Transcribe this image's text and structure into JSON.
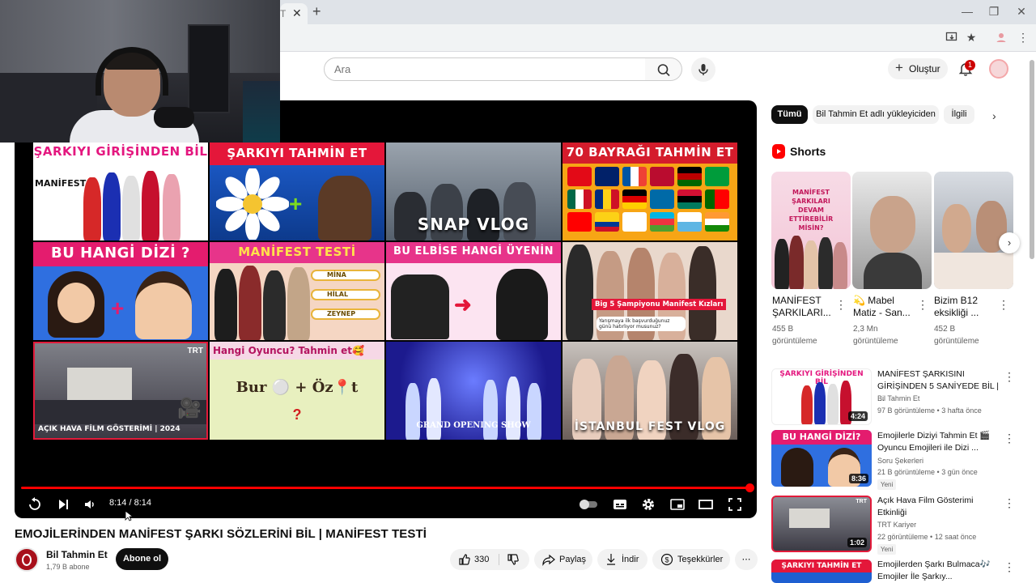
{
  "browser": {
    "tab_fragment": "T",
    "tab_close": "✕",
    "new_tab": "+",
    "window_controls": [
      "—",
      "❐",
      "✕"
    ]
  },
  "header": {
    "search_placeholder": "Ara",
    "create_label": "Oluştur",
    "notification_count": "1"
  },
  "player": {
    "time": "8:14 / 8:14",
    "progress_fraction": 1.0,
    "thumbnails": [
      {
        "title": "ŞARKIYI GİRİŞİNDEN BİL",
        "caption": "MANİFEST"
      },
      {
        "title": "ŞARKIYI TAHMİN ET",
        "caption": ""
      },
      {
        "title": "",
        "caption": "SNAP VLOG"
      },
      {
        "title": "70 BAYRAĞI TAHMİN ET",
        "caption": ""
      },
      {
        "title": "BU HANGİ DİZİ ?",
        "caption": ""
      },
      {
        "title": "MANİFEST TESTİ",
        "caption": "",
        "options": [
          "MİNA",
          "HİLAL",
          "ZEYNEP"
        ]
      },
      {
        "title": "BU ELBİSE HANGİ ÜYENİN",
        "caption": ""
      },
      {
        "title": "",
        "caption": "Big 5 Şampiyonu Manifest Kızları",
        "sub_caption": "Yarışmaya ilk başvurduğunuz günü hatırlıyor musunuz?"
      },
      {
        "title": "TRT",
        "caption": "AÇIK HAVA FİLM GÖSTERİMİ | 2024"
      },
      {
        "title": "Hangi Oyuncu? Tahmin et🥰",
        "caption": "Bur ⚪ + Öz📍t",
        "mark": "?"
      },
      {
        "title": "",
        "caption": "GRAND OPENING SHOW"
      },
      {
        "title": "",
        "caption": "İSTANBUL FEST VLOG"
      }
    ]
  },
  "video": {
    "title": "EMOJİLERİNDEN MANİFEST ŞARKI SÖZLERİNİ BİL | MANİFEST TESTİ",
    "channel_name": "Bil Tahmin Et",
    "subscribers": "1,79 B abone",
    "subscribe_label": "Abone ol",
    "likes": "330",
    "share_label": "Paylaş",
    "download_label": "İndir",
    "thanks_label": "Teşekkürler",
    "more": "⋯"
  },
  "sidebar": {
    "chips": [
      "Tümü",
      "Bil Tahmin Et adlı yükleyiciden",
      "İlgili"
    ],
    "shorts_title": "Shorts",
    "shorts": [
      {
        "title": "MANİFEST ŞARKILARI...",
        "views": "455 B görüntüleme",
        "overlay": "MANİFEST ŞARKILARI DEVAM ETTİREBİLİR MİSİN?"
      },
      {
        "title": "💫 Mabel Matiz - San...",
        "views": "2,3 Mn görüntüleme",
        "overlay": ""
      },
      {
        "title": "Bizim B12 eksikliği ...",
        "views": "452 B görüntüleme",
        "overlay": ""
      }
    ],
    "recommendations": [
      {
        "title": "MANİFEST ŞARKISINI GİRİŞİNDEN 5 SANİYEDE BİL | ...",
        "channel": "Bil Tahmin Et",
        "meta": "97 B görüntüleme • 3 hafta önce",
        "duration": "4:24",
        "badge": "",
        "thumb_text": "ŞARKIYI GİRİŞİNDEN BİL"
      },
      {
        "title": "Emojilerle Diziyi Tahmin Et 🎬 Oyuncu Emojileri ile Dizi ...",
        "channel": "Soru Şekerleri",
        "meta": "21 B görüntüleme • 3 gün önce",
        "duration": "8:36",
        "badge": "Yeni",
        "thumb_text": "BU HANGİ DİZİ?"
      },
      {
        "title": "Açık Hava Film Gösterimi Etkinliği",
        "channel": "TRT Kariyer",
        "meta": "22 görüntüleme • 12 saat önce",
        "duration": "1:02",
        "badge": "Yeni",
        "thumb_text": "TRT"
      },
      {
        "title": "Emojilerden Şarkı Bulmaca🎶 Emojiler İle Şarkıy...",
        "channel": "",
        "meta": "",
        "duration": "",
        "badge": "",
        "thumb_text": "ŞARKIYI TAHMİN ET"
      }
    ]
  },
  "colors": {
    "accent": "#ff0000",
    "subscribe_bg": "#0f0f0f"
  }
}
